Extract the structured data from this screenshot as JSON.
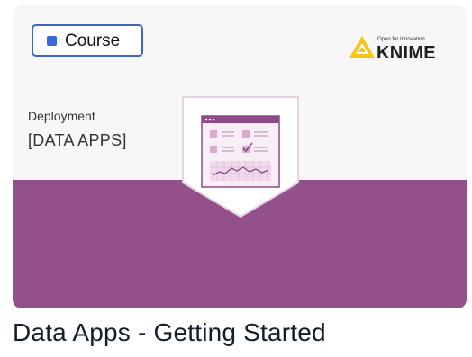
{
  "badge": {
    "label": "Course",
    "dot_color": "#3a68db",
    "border_color": "#3f64c2"
  },
  "logo": {
    "tagline": "Open for Innovation",
    "wordmark": "KNIME",
    "icon": "knime-triangle-icon",
    "accent_color": "#f5c518"
  },
  "card": {
    "category": "Deployment",
    "category_tag": "[DATA APPS]",
    "band_color": "#93508b",
    "emblem_icon": "dashboard-data-app-icon"
  },
  "course": {
    "title": "Data Apps - Getting Started"
  }
}
